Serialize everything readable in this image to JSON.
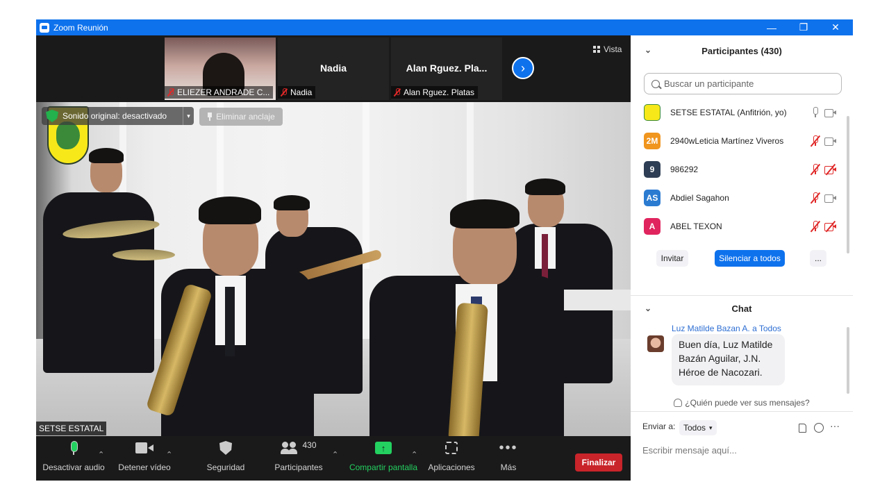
{
  "window": {
    "title": "Zoom Reunión",
    "controls": {
      "minimize": "—",
      "restore": "❐",
      "close": "✕"
    }
  },
  "strip": {
    "thumbnails": [
      {
        "name": "ELIEZER ANDRADE C..."
      },
      {
        "big_name": "Nadia",
        "name": "Nadia"
      },
      {
        "big_name": "Alan  Rguez. Pla...",
        "name": "Alan  Rguez. Platas"
      }
    ],
    "view_label": "Vista"
  },
  "video": {
    "sound_original": "Sonido original: desactivado",
    "unpin_label": "Eliminar anclaje",
    "speaker_label": "SETSE ESTATAL"
  },
  "toolbar": {
    "mute": "Desactivar audio",
    "stop_video": "Detener vídeo",
    "security": "Seguridad",
    "participants": "Participantes",
    "participants_count": "430",
    "share": "Compartir pantalla",
    "apps": "Aplicaciones",
    "more": "Más",
    "end": "Finalizar"
  },
  "participants_panel": {
    "title": "Participantes (430)",
    "search_placeholder": "Buscar un participante",
    "participants": [
      {
        "initials": "",
        "name": "SETSE ESTATAL (Anfitrión, yo)",
        "color": "#f7e81a",
        "mic": "on",
        "video": "on"
      },
      {
        "initials": "2M",
        "name": "2940wLeticia Martínez Viveros",
        "color": "#f0951e",
        "mic": "muted",
        "video": "on"
      },
      {
        "initials": "9",
        "name": "986292",
        "color": "#2e3e54",
        "mic": "muted",
        "video": "off"
      },
      {
        "initials": "AS",
        "name": "Abdiel Sagahon",
        "color": "#2b7bd1",
        "mic": "muted",
        "video": "on"
      },
      {
        "initials": "A",
        "name": "ABEL TEXON",
        "color": "#e0245e",
        "mic": "muted",
        "video": "off"
      }
    ],
    "invite": "Invitar",
    "mute_all": "Silenciar a todos",
    "more": "..."
  },
  "chat": {
    "title": "Chat",
    "from": "Luz Matilde Bazan A. a Todos",
    "message_lines": [
      "Buen día, Luz Matilde",
      "Bazán Aguilar, J.N.",
      "Héroe de Nacozari."
    ],
    "who_can_see": "¿Quién puede ver sus mensajes?",
    "send_to_label": "Enviar a:",
    "send_to_value": "Todos",
    "more": "···",
    "input_placeholder": "Escribir mensaje aquí..."
  },
  "colors": {
    "accent": "#0e72ed",
    "end_button": "#c8242a",
    "share_green": "#23d160",
    "muted_red": "#e02828"
  }
}
